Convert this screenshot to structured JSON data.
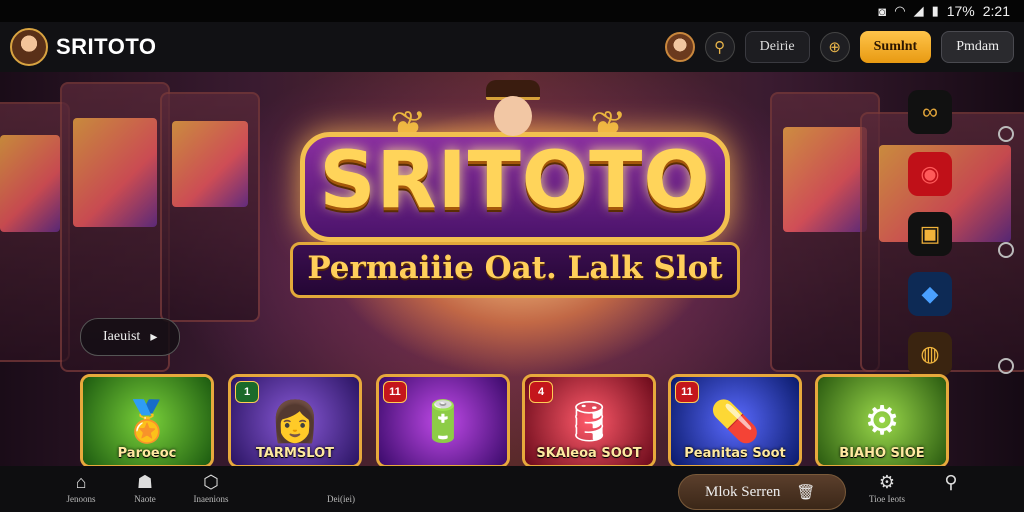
{
  "status_bar": {
    "battery": "17%",
    "time": "2:21"
  },
  "header": {
    "title": "SRITOTO",
    "login_label": "Deirie",
    "register_label": "Sumlnt",
    "account_label": "Pmdam"
  },
  "banner": {
    "title": "SRITOTO",
    "subtitle": "Permaiiie Oat. Lalk Slot",
    "chip_label": "Iaeuist"
  },
  "games": [
    {
      "name": "Paroeoc",
      "badge": ""
    },
    {
      "name": "TARMSLOT",
      "badge": "1"
    },
    {
      "name": "",
      "badge": "11"
    },
    {
      "name": "SKAleoa SOOT",
      "badge": "4"
    },
    {
      "name": "Peanitas Soot",
      "badge": "11"
    },
    {
      "name": "BIAHO SIOE",
      "badge": ""
    }
  ],
  "bottom_nav": {
    "items": [
      "Jenoons",
      "Naote",
      "Inaenions",
      "Dei(iei)"
    ],
    "action_label": "Mlok Serren",
    "right_item": "Tioe Ieots"
  },
  "colors": {
    "accent": "#e8a93c",
    "register_bg": "#f5ad22"
  }
}
